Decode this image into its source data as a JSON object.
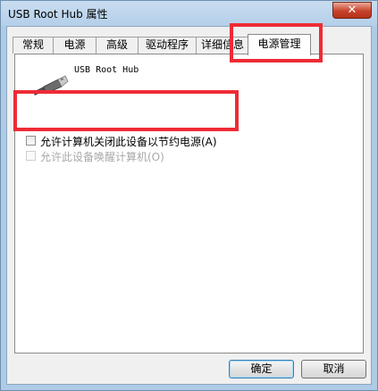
{
  "window": {
    "title": "USB Root Hub 属性",
    "close_glyph": "✕"
  },
  "tabs": [
    {
      "label": "常规"
    },
    {
      "label": "电源"
    },
    {
      "label": "高级"
    },
    {
      "label": "驱动程序"
    },
    {
      "label": "详细信息"
    },
    {
      "label": "电源管理",
      "selected": true
    }
  ],
  "panel": {
    "device_name": "USB Root Hub",
    "device_icon": "usb-plug-icon",
    "options": [
      {
        "label": "允许计算机关闭此设备以节约电源(A)",
        "checked": false,
        "enabled": true
      },
      {
        "label": "允许此设备唤醒计算机(O)",
        "checked": false,
        "enabled": false
      }
    ]
  },
  "buttons": {
    "ok": "确定",
    "cancel": "取消"
  },
  "colors": {
    "annotation": "#ee2b36",
    "titlebar": "#b4cfe9",
    "close_button": "#c7432a"
  }
}
